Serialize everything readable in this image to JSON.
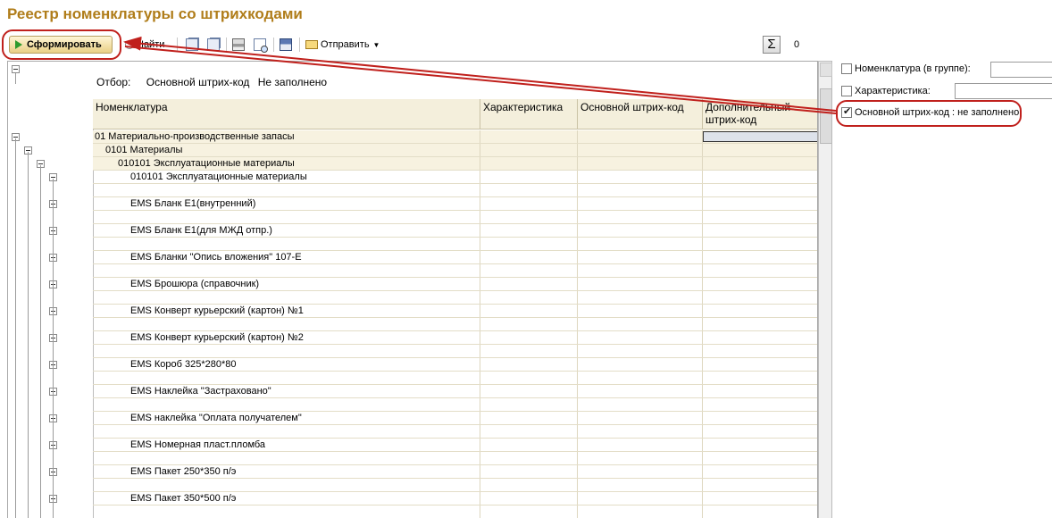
{
  "window": {
    "title": "Реестр номенклатуры со штрихкодами"
  },
  "toolbar": {
    "run_label": "Сформировать",
    "find_label": "Найти",
    "send_label": "Отправить",
    "sum_value": "0"
  },
  "filter": {
    "label": "Отбор:",
    "field": "Основной штрих-код",
    "condition": "Не заполнено"
  },
  "table": {
    "columns": [
      "Номенклатура",
      "Характеристика",
      "Основной штрих-код",
      "Дополнительный штрих-код"
    ],
    "rows": [
      {
        "name": "01 Материально-производственные запасы",
        "level": 0,
        "group": true
      },
      {
        "name": "0101 Материалы",
        "level": 1,
        "group": true
      },
      {
        "name": "010101 Эксплуатационные материалы",
        "level": 2,
        "group": true
      },
      {
        "name": "010101 Эксплуатационные материалы",
        "level": 3,
        "group": false
      },
      {
        "name": "EMS Бланк Е1(внутренний)",
        "level": 3,
        "group": false
      },
      {
        "name": "EMS Бланк Е1(для МЖД отпр.)",
        "level": 3,
        "group": false
      },
      {
        "name": "EMS Бланки \"Опись вложения\" 107-Е",
        "level": 3,
        "group": false
      },
      {
        "name": "EMS Брошюра (справочник)",
        "level": 3,
        "group": false
      },
      {
        "name": "EMS Конверт курьерский (картон) №1",
        "level": 3,
        "group": false
      },
      {
        "name": "EMS Конверт курьерский (картон) №2",
        "level": 3,
        "group": false
      },
      {
        "name": "EMS Короб 325*280*80",
        "level": 3,
        "group": false
      },
      {
        "name": "EMS Наклейка \"Застраховано\"",
        "level": 3,
        "group": false
      },
      {
        "name": "EMS наклейка \"Оплата получателем\"",
        "level": 3,
        "group": false
      },
      {
        "name": "EMS Номерная пласт.пломба",
        "level": 3,
        "group": false
      },
      {
        "name": "EMS Пакет 250*350 п/э",
        "level": 3,
        "group": false
      },
      {
        "name": "EMS Пакет 350*500 п/э",
        "level": 3,
        "group": false
      }
    ]
  },
  "settings": {
    "items": [
      {
        "label": "Номенклатура (в группе):",
        "checked": false
      },
      {
        "label": "Характеристика:",
        "checked": false
      },
      {
        "label": "Основной штрих-код : не заполнено",
        "checked": true
      }
    ]
  },
  "colors": {
    "title": "#b07d1a",
    "header_bg": "#f4efdc",
    "annotation": "#c0201c"
  }
}
